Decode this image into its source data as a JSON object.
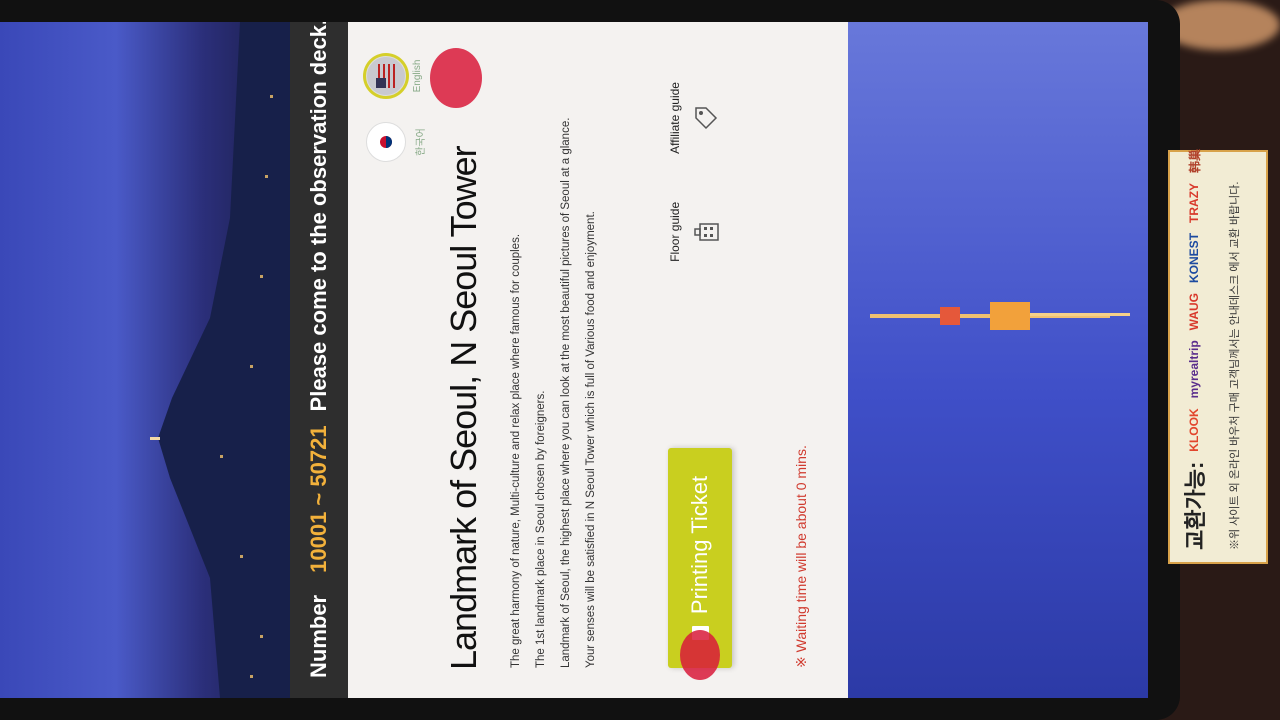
{
  "header": {
    "number_label": "Number",
    "number_range": "10001 ~ 50721",
    "message": "Please come to the observation deck."
  },
  "languages": [
    {
      "label": "한국어",
      "icon": "korea-flag-icon"
    },
    {
      "label": "English",
      "icon": "usa-flag-icon",
      "selected": true
    }
  ],
  "main": {
    "title": "Landmark of Seoul, N Seoul Tower",
    "paragraphs": [
      "The great harmony of nature, Multi-culture and relax place where famous for couples.",
      "The 1st landmark place in Seoul chosen by foreigners.",
      "Landmark of Seoul, the highest place where you can look at the most beautiful pictures of Seoul at a glance.",
      "Your senses will be satisfied in N Seoul Tower which is full of Various food and enjoyment."
    ],
    "print_button": "Printing Ticket",
    "guides": [
      "Floor guide",
      "Affiliate guide"
    ],
    "waiting": "※ Waiting time will be about 0 mins."
  },
  "sticker": {
    "headline": "교환가능:",
    "brands": [
      "KLOOK",
      "myrealtrip",
      "WAUG",
      "KONEST",
      "TRAZY",
      "韩巢"
    ],
    "note": "※위 사이트 외 온라인 바우처 구매 고객님께서는 안내데스크 에서 교환 바랍니다."
  },
  "colors": {
    "accent_button": "#c9cf1f",
    "number_range": "#f2b13b",
    "waiting_text": "#d03a2e",
    "header_bar": "#2e2e2e"
  }
}
